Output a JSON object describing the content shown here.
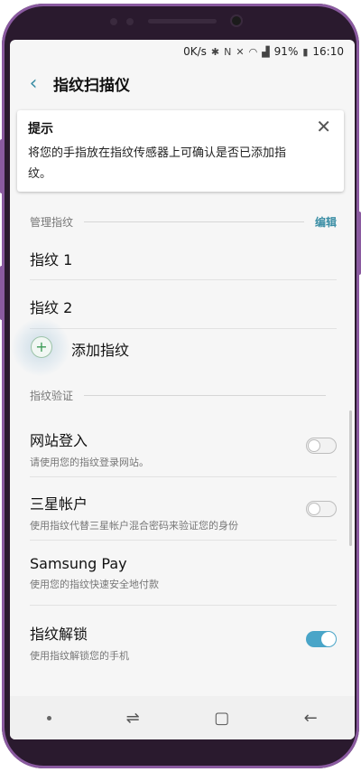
{
  "status_bar": {
    "speed": "0K/s",
    "icons": [
      "bluetooth-icon",
      "nfc-icon",
      "mute-icon",
      "wifi-icon",
      "signal-icon"
    ],
    "battery": "91%",
    "time": "16:10"
  },
  "header": {
    "title": "指纹扫描仪"
  },
  "tip": {
    "title": "提示",
    "body": "将您的手指放在指纹传感器上可确认是否已添加指纹。"
  },
  "manage_section": {
    "label": "管理指纹",
    "action": "编辑"
  },
  "fingerprints": [
    {
      "label": "指纹 1"
    },
    {
      "label": "指纹 2"
    }
  ],
  "add_fingerprint": {
    "label": "添加指纹"
  },
  "verify_section": {
    "label": "指纹验证"
  },
  "settings": [
    {
      "label": "网站登入",
      "sub": "请使用您的指纹登录网站。",
      "toggle": "off"
    },
    {
      "label": "三星帐户",
      "sub": "使用指纹代替三星帐户混合密码来验证您的身份",
      "toggle": "off"
    },
    {
      "label": "Samsung Pay",
      "sub": "使用您的指纹快速安全地付款",
      "toggle": null
    },
    {
      "label": "指纹解锁",
      "sub": "使用指纹解锁您的手机",
      "toggle": "on"
    }
  ],
  "colors": {
    "accent": "#3b8ea5",
    "toggle_on": "#49a5c8",
    "frame": "#8a5aa0"
  }
}
